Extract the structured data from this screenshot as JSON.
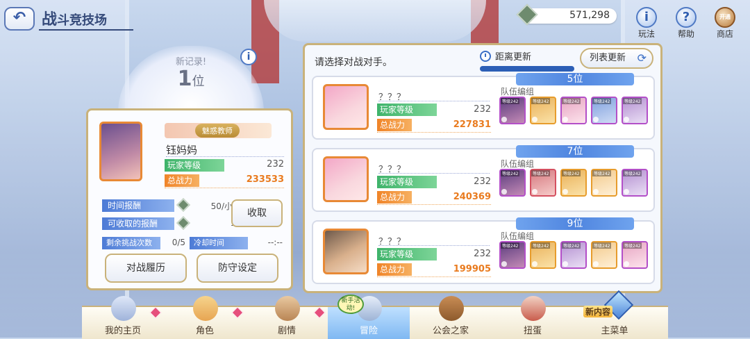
{
  "header": {
    "back_icon": "↶",
    "title_big": "战",
    "title_rest": "斗竞技场",
    "currency_value": "571,298",
    "buttons": [
      {
        "label": "玩法",
        "icon": "i"
      },
      {
        "label": "帮助",
        "icon": "?"
      },
      {
        "label": "商店",
        "icon": "开通"
      }
    ]
  },
  "record": {
    "label": "新记录!",
    "rank_num": "1",
    "rank_unit": "位",
    "info_icon": "i"
  },
  "player": {
    "badge_title": "魅惑教师",
    "name": "钰妈妈",
    "level_label": "玩家等级",
    "level": "232",
    "power_label": "总战力",
    "power": "233533",
    "rewards": [
      {
        "label": "时间报酬",
        "value": "50/小时"
      },
      {
        "label": "可收取的报酬",
        "value": "15"
      }
    ],
    "collect_label": "收取",
    "challenges_label": "剩余挑战次数",
    "challenges_value": "0/5",
    "cooldown_label": "冷却时间",
    "cooldown_value": "--:--",
    "history_label": "对战履历",
    "defense_label": "防守设定"
  },
  "opponents_panel": {
    "prompt": "请选择对战对手。",
    "refresh_timer_label": "距离更新",
    "refresh_button": "列表更新",
    "refresh_icon": "⟳",
    "team_label": "队伍编组",
    "level_label": "玩家等级",
    "power_label": "总战力"
  },
  "opponents": [
    {
      "rank": "5位",
      "name": "？？？",
      "level": "232",
      "power": "227831"
    },
    {
      "rank": "7位",
      "name": "？？？",
      "level": "232",
      "power": "240369"
    },
    {
      "rank": "9位",
      "name": "？？？",
      "level": "232",
      "power": "199905"
    }
  ],
  "team_level_tag": "等级242",
  "bottom_nav": {
    "items": [
      "我的主页",
      "角色",
      "剧情",
      "冒险",
      "公会之家",
      "扭蛋",
      "主菜单"
    ],
    "event_badge": "新手活动!",
    "new_content": "新内容"
  },
  "colors": {
    "accent_blue": "#4f85df",
    "power_orange": "#e97b1f",
    "level_green": "#3eb36a",
    "frame_gold": "#c9b27a"
  }
}
